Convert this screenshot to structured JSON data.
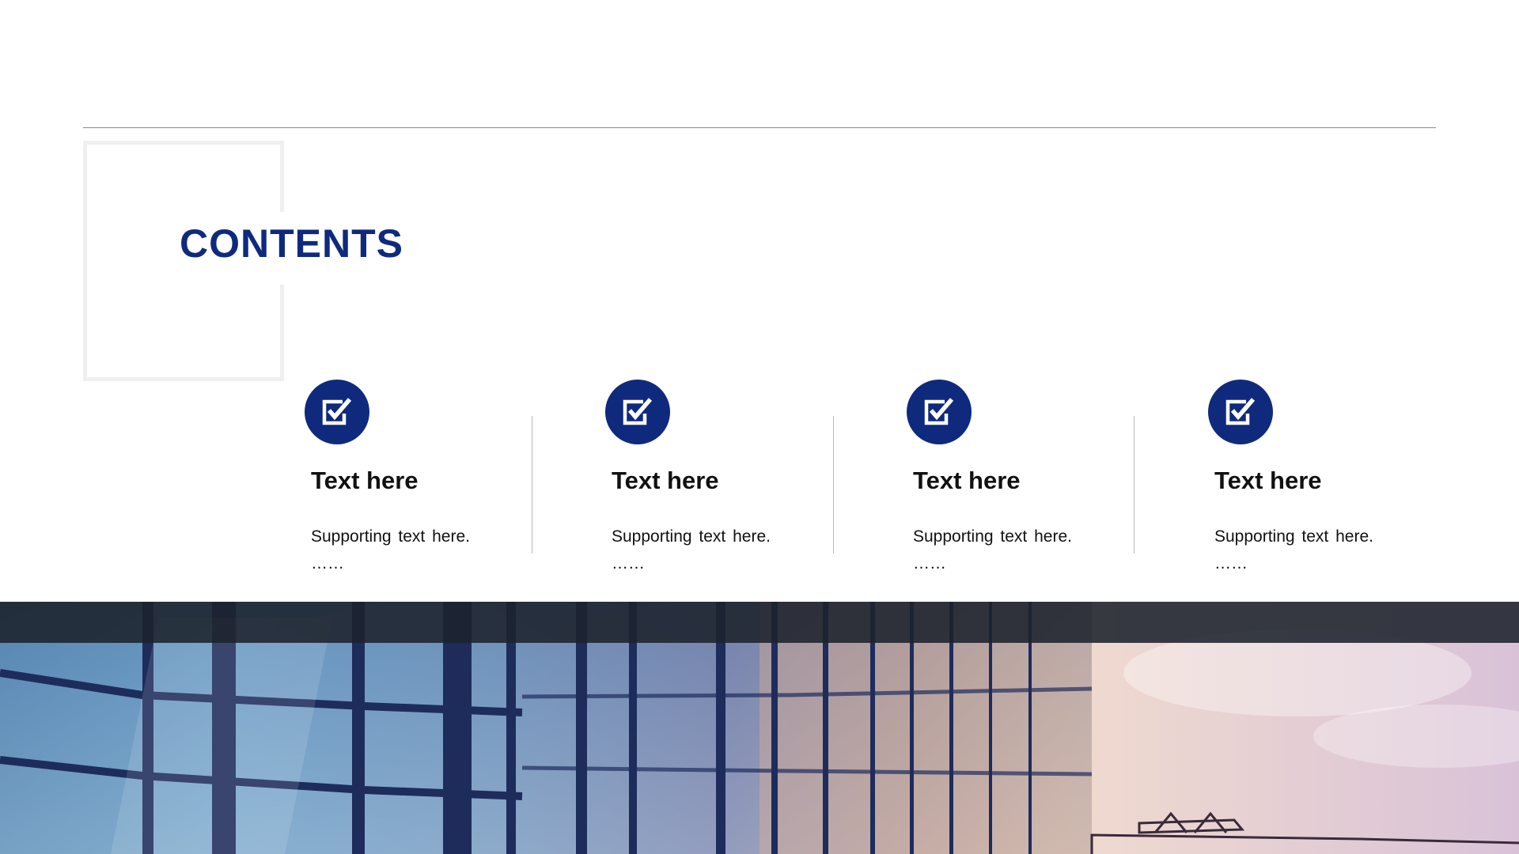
{
  "slide": {
    "title": "CONTENTS",
    "accent_color": "#0f2a7d",
    "item_icon": "checkbox-check-icon",
    "items": [
      {
        "title": "Text here",
        "description": "Supporting text here.",
        "ellipsis": "……"
      },
      {
        "title": "Text here",
        "description": "Supporting text here.",
        "ellipsis": "……"
      },
      {
        "title": "Text here",
        "description": "Supporting text here.",
        "ellipsis": "……"
      },
      {
        "title": "Text here",
        "description": "Supporting text here.",
        "ellipsis": "……"
      }
    ]
  }
}
